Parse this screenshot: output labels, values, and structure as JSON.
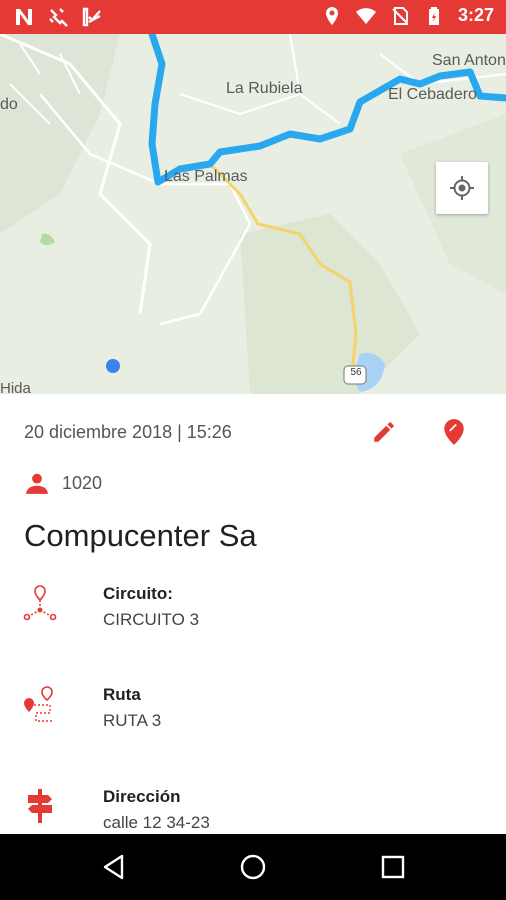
{
  "status_bar": {
    "time": "3:27",
    "left_icons": [
      "n-app-icon",
      "satellite-icon",
      "checklist-app-icon"
    ],
    "right_icons": [
      "location-icon",
      "wifi-icon",
      "no-sim-icon",
      "battery-icon"
    ]
  },
  "map": {
    "labels": [
      "La Rubiela",
      "San Anton",
      "El Cebadero",
      "Las Palmas",
      "do",
      "Hida"
    ],
    "road_shield": "56",
    "route_color": "#29a8f0",
    "road_color": "#f5d36b",
    "locate_button_icon": "my-location-icon"
  },
  "visit": {
    "datetime": "20 diciembre 2018 | 15:26",
    "user_code": "1020",
    "client_name": "Compucenter Sa",
    "edit_icon": "pencil-icon",
    "location_icon": "map-pin-icon"
  },
  "info_items": [
    {
      "label": "Circuito:",
      "value": "CIRCUITO 3",
      "icon": "circuit-icon"
    },
    {
      "label": "Ruta",
      "value": "RUTA 3",
      "icon": "route-icon"
    },
    {
      "label": "Dirección",
      "value": "calle 12 34-23",
      "icon": "signpost-icon"
    }
  ],
  "nav_bar": {
    "buttons": [
      "back-icon",
      "home-icon",
      "recents-icon"
    ]
  },
  "accent_color": "#e53935"
}
